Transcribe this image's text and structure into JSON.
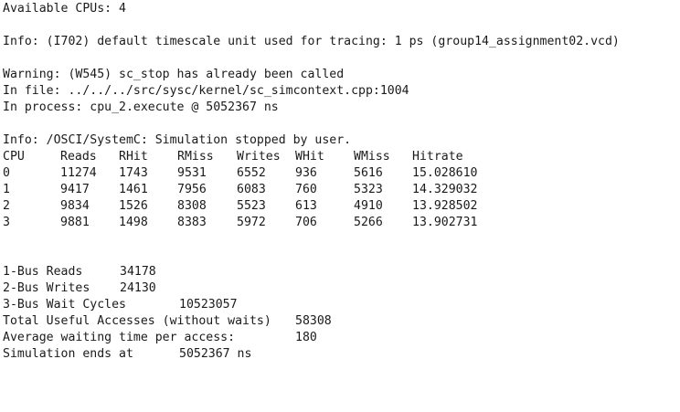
{
  "console": {
    "line_cpus": "Available CPUs: 4",
    "line_info_timescale": "Info: (I702) default timescale unit used for tracing: 1 ps (group14_assignment02.vcd)",
    "line_warning": "Warning: (W545) sc_stop has already been called",
    "line_file": "In file: ../../../src/sysc/kernel/sc_simcontext.cpp:1004",
    "line_process": "In process: cpu_2.execute @ 5052367 ns",
    "line_info_stopped": "Info: /OSCI/SystemC: Simulation stopped by user."
  },
  "table": {
    "headers": [
      "CPU",
      "Reads",
      "RHit",
      "RMiss",
      "Writes",
      "WHit",
      "WMiss",
      "Hitrate"
    ],
    "rows": [
      [
        "0",
        "11274",
        "1743",
        "9531",
        "6552",
        "936",
        "5616",
        "15.028610"
      ],
      [
        "1",
        "9417",
        "1461",
        "7956",
        "6083",
        "760",
        "5323",
        "14.329032"
      ],
      [
        "2",
        "9834",
        "1526",
        "8308",
        "5523",
        "613",
        "4910",
        "13.928502"
      ],
      [
        "3",
        "9881",
        "1498",
        "8383",
        "5972",
        "706",
        "5266",
        "13.902731"
      ]
    ]
  },
  "summary": {
    "bus_reads_label": "1-Bus Reads",
    "bus_reads_value": "34178",
    "bus_writes_label": "2-Bus Writes",
    "bus_writes_value": "24130",
    "bus_wait_label": "3-Bus Wait Cycles",
    "bus_wait_value": "10523057",
    "useful_label": "Total Useful Accesses (without waits)",
    "useful_value": "58308",
    "avg_wait_label": "Average waiting time per access:",
    "avg_wait_value": "180",
    "sim_end_label": "Simulation ends at",
    "sim_end_value": "5052367 ns"
  }
}
